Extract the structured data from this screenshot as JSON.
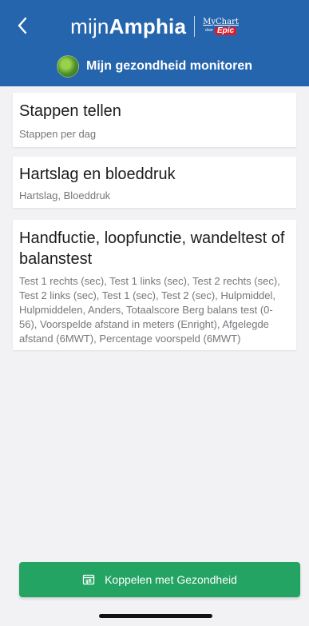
{
  "header": {
    "back_icon": "chevron-left-icon",
    "brand_prefix": "mijn",
    "brand_bold": "Amphia",
    "mychart": "MyChart",
    "mychart_door": "door",
    "epic": "Epic",
    "subtitle": "Mijn gezondheid monitoren",
    "color": "#2565ad"
  },
  "cards": [
    {
      "title": "Stappen tellen",
      "description": "Stappen per dag"
    },
    {
      "title": "Hartslag en bloeddruk",
      "description": "Hartslag, Bloeddruk"
    },
    {
      "title": "Handfuctie, loopfunctie, wandeltest of balanstest",
      "description": "Test 1 rechts (sec), Test 1 links (sec), Test 2 rechts (sec), Test 2 links (sec), Test 1 (sec), Test 2 (sec), Hulpmiddel, Hulpmiddelen, Anders, Totaalscore Berg balans test (0-56), Voorspelde afstand in meters (Enright), Afgelegde afstand (6MWT), Percentage voorspeld (6MWT)"
    }
  ],
  "connect_button": {
    "label": "Koppelen met Gezondheid",
    "icon": "link-document-icon",
    "color": "#23a463"
  }
}
